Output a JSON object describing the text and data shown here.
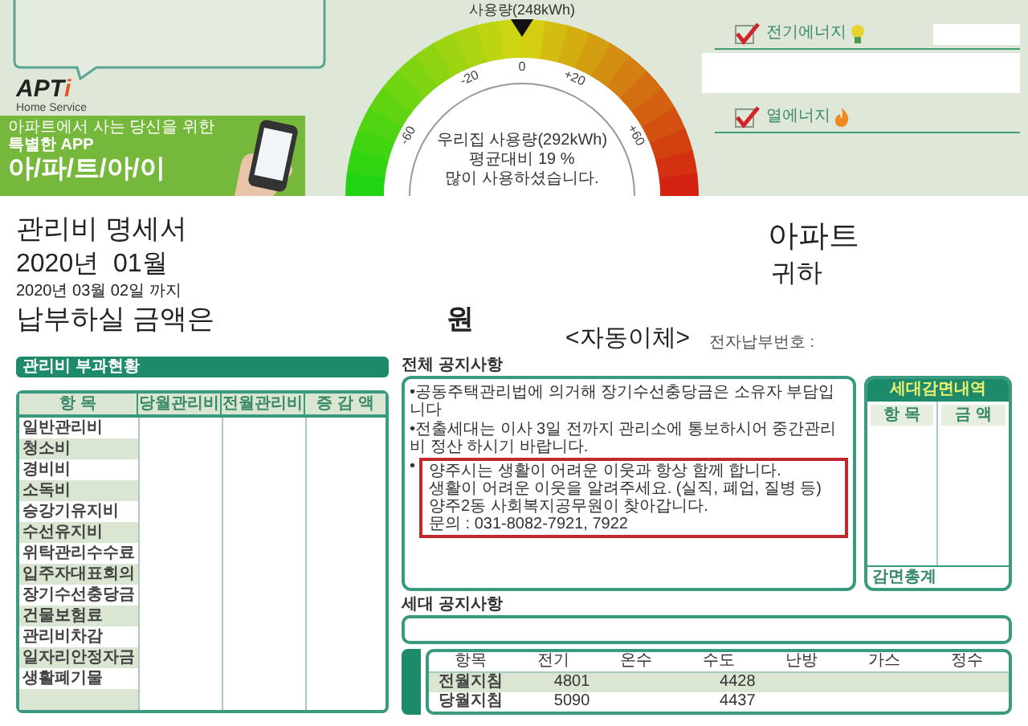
{
  "energy_report": {
    "caption": "사용량(248kWh)",
    "gauge": {
      "ticks": [
        "-60",
        "-20",
        "0",
        "+20",
        "+60"
      ],
      "lines": [
        "우리집 사용량(292kWh)",
        "평균대비 19 %",
        "많이 사용하셨습니다."
      ]
    },
    "energy_types": [
      {
        "kind": "electric",
        "label": "전기에너지",
        "checked": true
      },
      {
        "kind": "heat",
        "label": "열에너지",
        "checked": true
      }
    ]
  },
  "app_promo": {
    "logo": "APT",
    "logo_mark": "i",
    "logo_sub": "Home Service",
    "tagline": "아파트에서 사는 당신을 위한 **특별한 APP**",
    "title": "아/파/트/아/이"
  },
  "statement": {
    "title": "관리비 명세서",
    "period": "2020년  01월",
    "due": "2020년 03월 02일 까지",
    "amount_label": "납부하실 금액은",
    "amount_unit": "원",
    "apartment": "아파트",
    "honorific": "귀하",
    "payment_method": "<자동이체>",
    "epay_label": "전자납부번호 :"
  },
  "charges": {
    "title": "관리비 부과현황",
    "columns": [
      "항 목",
      "당월관리비",
      "전월관리비",
      "증 감 액"
    ],
    "rows": [
      "일반관리비",
      "청소비",
      "경비비",
      "소독비",
      "승강기유지비",
      "수선유지비",
      "위탁관리수수료",
      "입주자대표회의",
      "장기수선충당금",
      "건물보험료",
      "관리비차감",
      "일자리안정자금",
      "생활폐기물"
    ]
  },
  "notices": {
    "title": "전체 공지사항",
    "items": [
      "•공동주택관리법에 의거해 장기수선충당금은 소유자 부담입니다",
      "•전출세대는 이사 3일 전까지 관리소에 통보하시어 중간관리비 정산 하시기 바랍니다."
    ],
    "highlight": {
      "bullet": "•",
      "lines": [
        "양주시는 생활이 어려운 이웃과 항상 함께 합니다.",
        "생활이 어려운 이웃을 알려주세요. (실직, 폐업, 질병 등)",
        "양주2동 사회복지공무원이 찾아갑니다.",
        "문의 : 031-8082-7921, 7922"
      ]
    }
  },
  "deductions": {
    "title": "세대감면내역",
    "columns": [
      "항 목",
      "금 액"
    ],
    "total_label": "감면총계"
  },
  "household_notice": {
    "title": "세대 공지사항"
  },
  "meters": {
    "columns": [
      "항목",
      "전기",
      "온수",
      "수도",
      "난방",
      "가스",
      "정수"
    ],
    "rows": [
      {
        "label": "전월지침",
        "electricity": "4801",
        "water": "4428"
      },
      {
        "label": "당월지침",
        "electricity": "5090",
        "water": "4437"
      }
    ]
  }
}
